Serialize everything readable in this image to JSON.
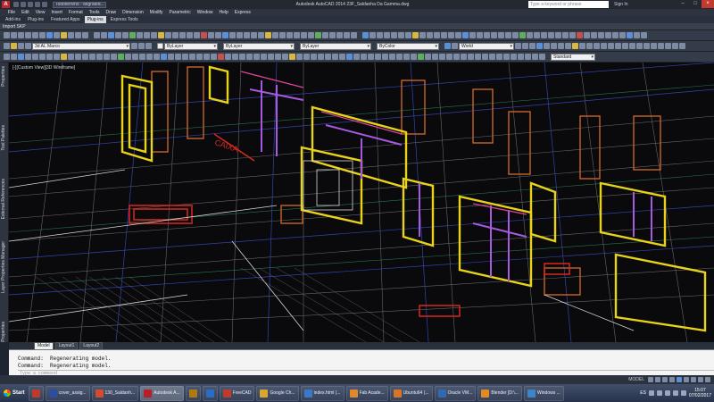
{
  "titlebar": {
    "doc_tab": "Todoterreno - Migrated...",
    "app_title": "Autodesk AutoCAD 2014   23F_Saldanha Da Gamma.dwg",
    "search_placeholder": "Type a keyword or phrase",
    "sign_in": "Sign In"
  },
  "menu": [
    "File",
    "Edit",
    "View",
    "Insert",
    "Format",
    "Tools",
    "Draw",
    "Dimension",
    "Modify",
    "Parametric",
    "Window",
    "Help",
    "Express"
  ],
  "ribbon_tabs": [
    "Add-ins",
    "Plug-ins",
    "Featured Apps",
    "Plug-ins",
    "Express Tools"
  ],
  "ribbon_active_index": 3,
  "panel_label": "Import SKP",
  "toolbars": {
    "layer": "3d AL Marco",
    "color": "ByLayer",
    "linetype": "ByLayer",
    "lineweight": "ByLayer",
    "plotstyle": "ByColor",
    "ucs": "World",
    "style": "Standard"
  },
  "viewport": {
    "label": "[-][Custom View][3D Wireframe]",
    "annotations": [
      "CAIXA"
    ]
  },
  "palette": [
    "Properties",
    "Tool Palettes",
    "External References",
    "Layer Properties Manager",
    "Properties"
  ],
  "layout_tabs": [
    "Model",
    "Layout1",
    "Layout2"
  ],
  "layout_active_index": 0,
  "command": {
    "line1": "Command:  Regenerating model.",
    "line2": "Command:  Regenerating model.",
    "prompt": "Type a command"
  },
  "status": {
    "model_label": "MODEL"
  },
  "taskbar": {
    "start": "Start",
    "items": [
      {
        "label": "",
        "color": "#c03a2b"
      },
      {
        "label": "cover_assig...",
        "color": "#2b4f9c"
      },
      {
        "label": "130_Saldanh...",
        "color": "#d24a30"
      },
      {
        "label": "Autodesk A...",
        "color": "#b81f2a"
      },
      {
        "label": "",
        "color": "#b07a10"
      },
      {
        "label": "",
        "color": "#2b6cc4"
      },
      {
        "label": "FreeCAD",
        "color": "#c23a2a"
      },
      {
        "label": "Google Ch...",
        "color": "#d9a52c"
      },
      {
        "label": "index.html (...",
        "color": "#3a78c9"
      },
      {
        "label": "Fab Acade...",
        "color": "#e0882b"
      },
      {
        "label": "Ubuntu64 (...",
        "color": "#d8742a"
      },
      {
        "label": "Oracle VM...",
        "color": "#2f6ab3"
      },
      {
        "label": "Blender [D:\\...",
        "color": "#e38a24"
      },
      {
        "label": "Windows ...",
        "color": "#3f83c8"
      }
    ],
    "active_index": 3,
    "language": "ES",
    "time": "15:07",
    "date": "07/02/2017"
  }
}
